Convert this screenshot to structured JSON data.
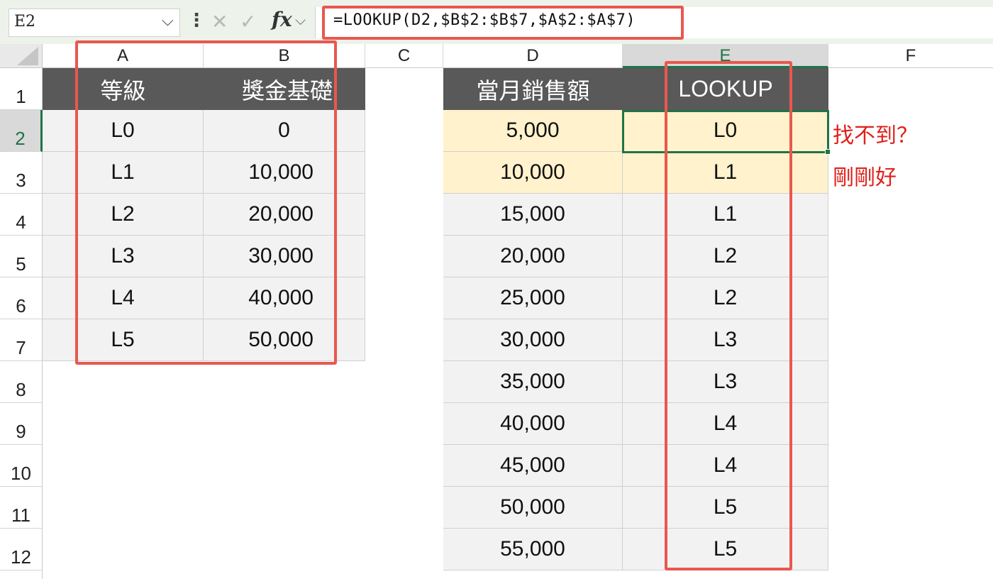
{
  "formula_bar": {
    "name_box": "E2",
    "formula": "=LOOKUP(D2,$B$2:$B$7,$A$2:$A$7)"
  },
  "columns": [
    "A",
    "B",
    "C",
    "D",
    "E",
    "F"
  ],
  "rows": [
    "1",
    "2",
    "3",
    "4",
    "5",
    "6",
    "7",
    "8",
    "9",
    "10",
    "11",
    "12"
  ],
  "table1": {
    "headers": [
      "等級",
      "獎金基礎"
    ],
    "rows": [
      [
        "L0",
        "0"
      ],
      [
        "L1",
        "10,000"
      ],
      [
        "L2",
        "20,000"
      ],
      [
        "L3",
        "30,000"
      ],
      [
        "L4",
        "40,000"
      ],
      [
        "L5",
        "50,000"
      ]
    ]
  },
  "table2": {
    "headers": [
      "當月銷售額",
      "LOOKUP"
    ],
    "rows": [
      [
        "5,000",
        "L0"
      ],
      [
        "10,000",
        "L1"
      ],
      [
        "15,000",
        "L1"
      ],
      [
        "20,000",
        "L2"
      ],
      [
        "25,000",
        "L2"
      ],
      [
        "30,000",
        "L3"
      ],
      [
        "35,000",
        "L3"
      ],
      [
        "40,000",
        "L4"
      ],
      [
        "45,000",
        "L4"
      ],
      [
        "50,000",
        "L5"
      ],
      [
        "55,000",
        "L5"
      ]
    ]
  },
  "annotations": {
    "row2_note": "找不到？",
    "row3_note": "剛剛好"
  },
  "colors": {
    "header_fill": "#595959",
    "highlight_fill": "#fff2cc",
    "body_fill": "#f2f2f2",
    "callout_red": "#e8584f",
    "note_red": "#e0201b",
    "excel_green": "#217346"
  }
}
